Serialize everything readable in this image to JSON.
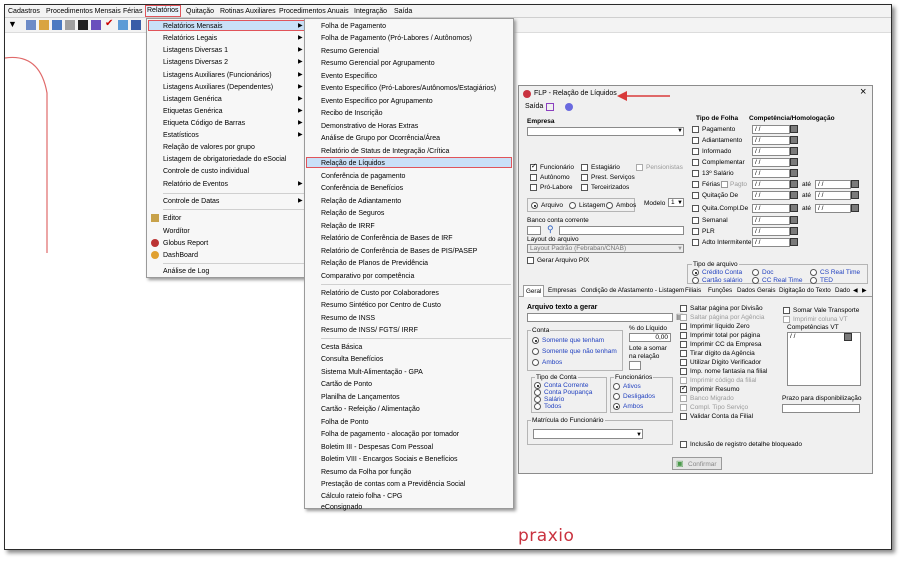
{
  "menubar": {
    "items": [
      "Cadastros",
      "Procedimentos Mensais",
      "Férias",
      "Relatórios",
      "Quitação",
      "Rotinas Auxiliares",
      "Procedimentos Anuais",
      "Integração",
      "Saída"
    ]
  },
  "reports_menu": {
    "items": [
      "Relatórios Mensais",
      "Relatórios Legais",
      "Listagens Diversas 1",
      "Listagens Diversas 2",
      "Listagens Auxiliares (Funcionários)",
      "Listagens Auxiliares (Dependentes)",
      "Listagem Genérica",
      "Etiquetas Genérica",
      "Etiqueta Código de Barras",
      "Estatísticos",
      "Relação de valores por grupo",
      "Listagem de obrigatoriedade do eSocial",
      "Controle de custo individual",
      "Relatório de Eventos",
      "Controle de Datas",
      "Editor",
      "Wordítor",
      "Globus Report",
      "DashBoard",
      "Análise de Log"
    ]
  },
  "monthly_menu": {
    "items": [
      "Folha de Pagamento",
      "Folha de Pagamento (Pró-Labores / Autônomos)",
      "Resumo Gerencial",
      "Resumo Gerencial por Agrupamento",
      "Evento Específico",
      "Evento Específico (Pró-Labores/Autônomos/Estagiários)",
      "Evento Específico por Agrupamento",
      "Recibo de Inscrição",
      "Demonstrativo de Horas Extras",
      "Análise de Grupo por Ocorrência/Área",
      "Relatório de Status de Integração /Crítica",
      "Relação de Líquidos",
      "Conferência de pagamento",
      "Conferência de Benefícios",
      "Relação de Adiantamento",
      "Relação de Seguros",
      "Relação de IRRF",
      "Relatório de Conferência de Bases de IRF",
      "Relatório de Conferência de Bases de PIS/PASEP",
      "Relação de Planos de Previdência",
      "Comparativo por competência",
      "Relatório de Custo por Colaboradores",
      "Resumo Sintético por Centro de Custo",
      "Resumo de INSS",
      "Resumo de INSS/ FGTS/ IRRF",
      "Cesta Básica",
      "Consulta Benefícios",
      "Sistema Mult-Alimentação - GPA",
      "Cartão de Ponto",
      "Planilha de Lançamentos",
      "Cartão - Refeição / Alimentação",
      "Folha de Ponto",
      "Folha de pagamento - alocação por tomador",
      "Boletim III - Despesas Com Pessoal",
      "Boletim VIII - Encargos Sociais e Benefícios",
      "Resumo da Folha por função",
      "Prestação de contas com a Previdência Social",
      "Cálculo rateio folha - CPG",
      "eConsignado"
    ]
  },
  "dialog": {
    "title": "FLP - Relação de Líquidos",
    "close": "×",
    "menu_exit": "Saída",
    "empresa_label": "Empresa",
    "tipo_folha_label": "Tipo de Folha",
    "competencia_label": "Competência/Homologação",
    "folha_tipos": [
      "Pagamento",
      "Adiantamento",
      "Informado",
      "Complementar",
      "13º Salário",
      "Férias",
      "Quitação De",
      "Quita.Compl.De",
      "Semanal",
      "PLR",
      "Adto Intermitente"
    ],
    "pagto_label": "Pagto",
    "ate_label": "até",
    "date_placeholder": "/ /",
    "vinculos": [
      "Funcionário",
      "Autônomo",
      "Pró-Labore",
      "Estagiário",
      "Prest. Serviços",
      "Terceirizados",
      "Pensionistas"
    ],
    "destino": [
      "Arquivo",
      "Listagem",
      "Ambos"
    ],
    "modelo_label": "Modelo",
    "modelo_value": "1",
    "banco_label": "Banco conta corrente",
    "layout_label": "Layout do arquivo",
    "layout_value": "Layout Padrão (Febraban/CNAB)",
    "gerar_pix": "Gerar Arquivo PIX",
    "tipo_arquivo_label": "Tipo de arquivo",
    "tipo_arquivo": [
      "Crédito Conta",
      "Cartão salário",
      "Doc",
      "CC Real Time",
      "CS Real Time",
      "TED"
    ],
    "tabs": [
      "Geral",
      "Empresas",
      "Condição de Afastamento - Listagem",
      "Filiais",
      "Funções",
      "Dados Gerais",
      "Digitação do Texto",
      "Dado"
    ],
    "arquivo_texto_label": "Arquivo texto a gerar",
    "conta_label": "Conta",
    "conta_opts": [
      "Somente que tenham",
      "Somente que não tenham",
      "Ambos"
    ],
    "pct_liquido_label": "% do Líquido",
    "pct_liquido_value": "0,00",
    "lote_label": "Lote a somar na relação",
    "tipo_conta_label": "Tipo de Conta",
    "tipo_conta_opts": [
      "Conta Corrente",
      "Conta Poupança",
      "Salário",
      "Todos"
    ],
    "funcionarios_label": "Funcionários",
    "funcionarios_opts": [
      "Ativos",
      "Desligados",
      "Ambos"
    ],
    "matricula_label": "Matrícula do Funcionário",
    "options_mid": [
      "Saltar página por Divisão",
      "Saltar página por Agência",
      "Imprimir líquido Zero",
      "Imprimir total por página",
      "Imprimir CC da Empresa",
      "Tirar dígito da Agência",
      "Utilizar Dígito Verificador",
      "Imp. nome fantasia na filial",
      "Imprimir código da filial",
      "Imprimir Resumo",
      "Banco Migrado",
      "Compl. Tipo Serviço",
      "Validar Conta da Filial"
    ],
    "options_right": [
      "Somar Vale Transporte",
      "Imprimir coluna VT"
    ],
    "competencias_vt_label": "Competências VT",
    "prazo_label": "Prazo para disponibilização",
    "inclusao_label": "Inclusão de registro detalhe bloqueado",
    "confirmar": "Confirmar"
  },
  "brand": "praxio",
  "colors": {
    "accent_red": "#e0545a",
    "highlight": "#c9e0f7",
    "brand": "#c9323f",
    "radio_blue": "#1f3fbf"
  }
}
